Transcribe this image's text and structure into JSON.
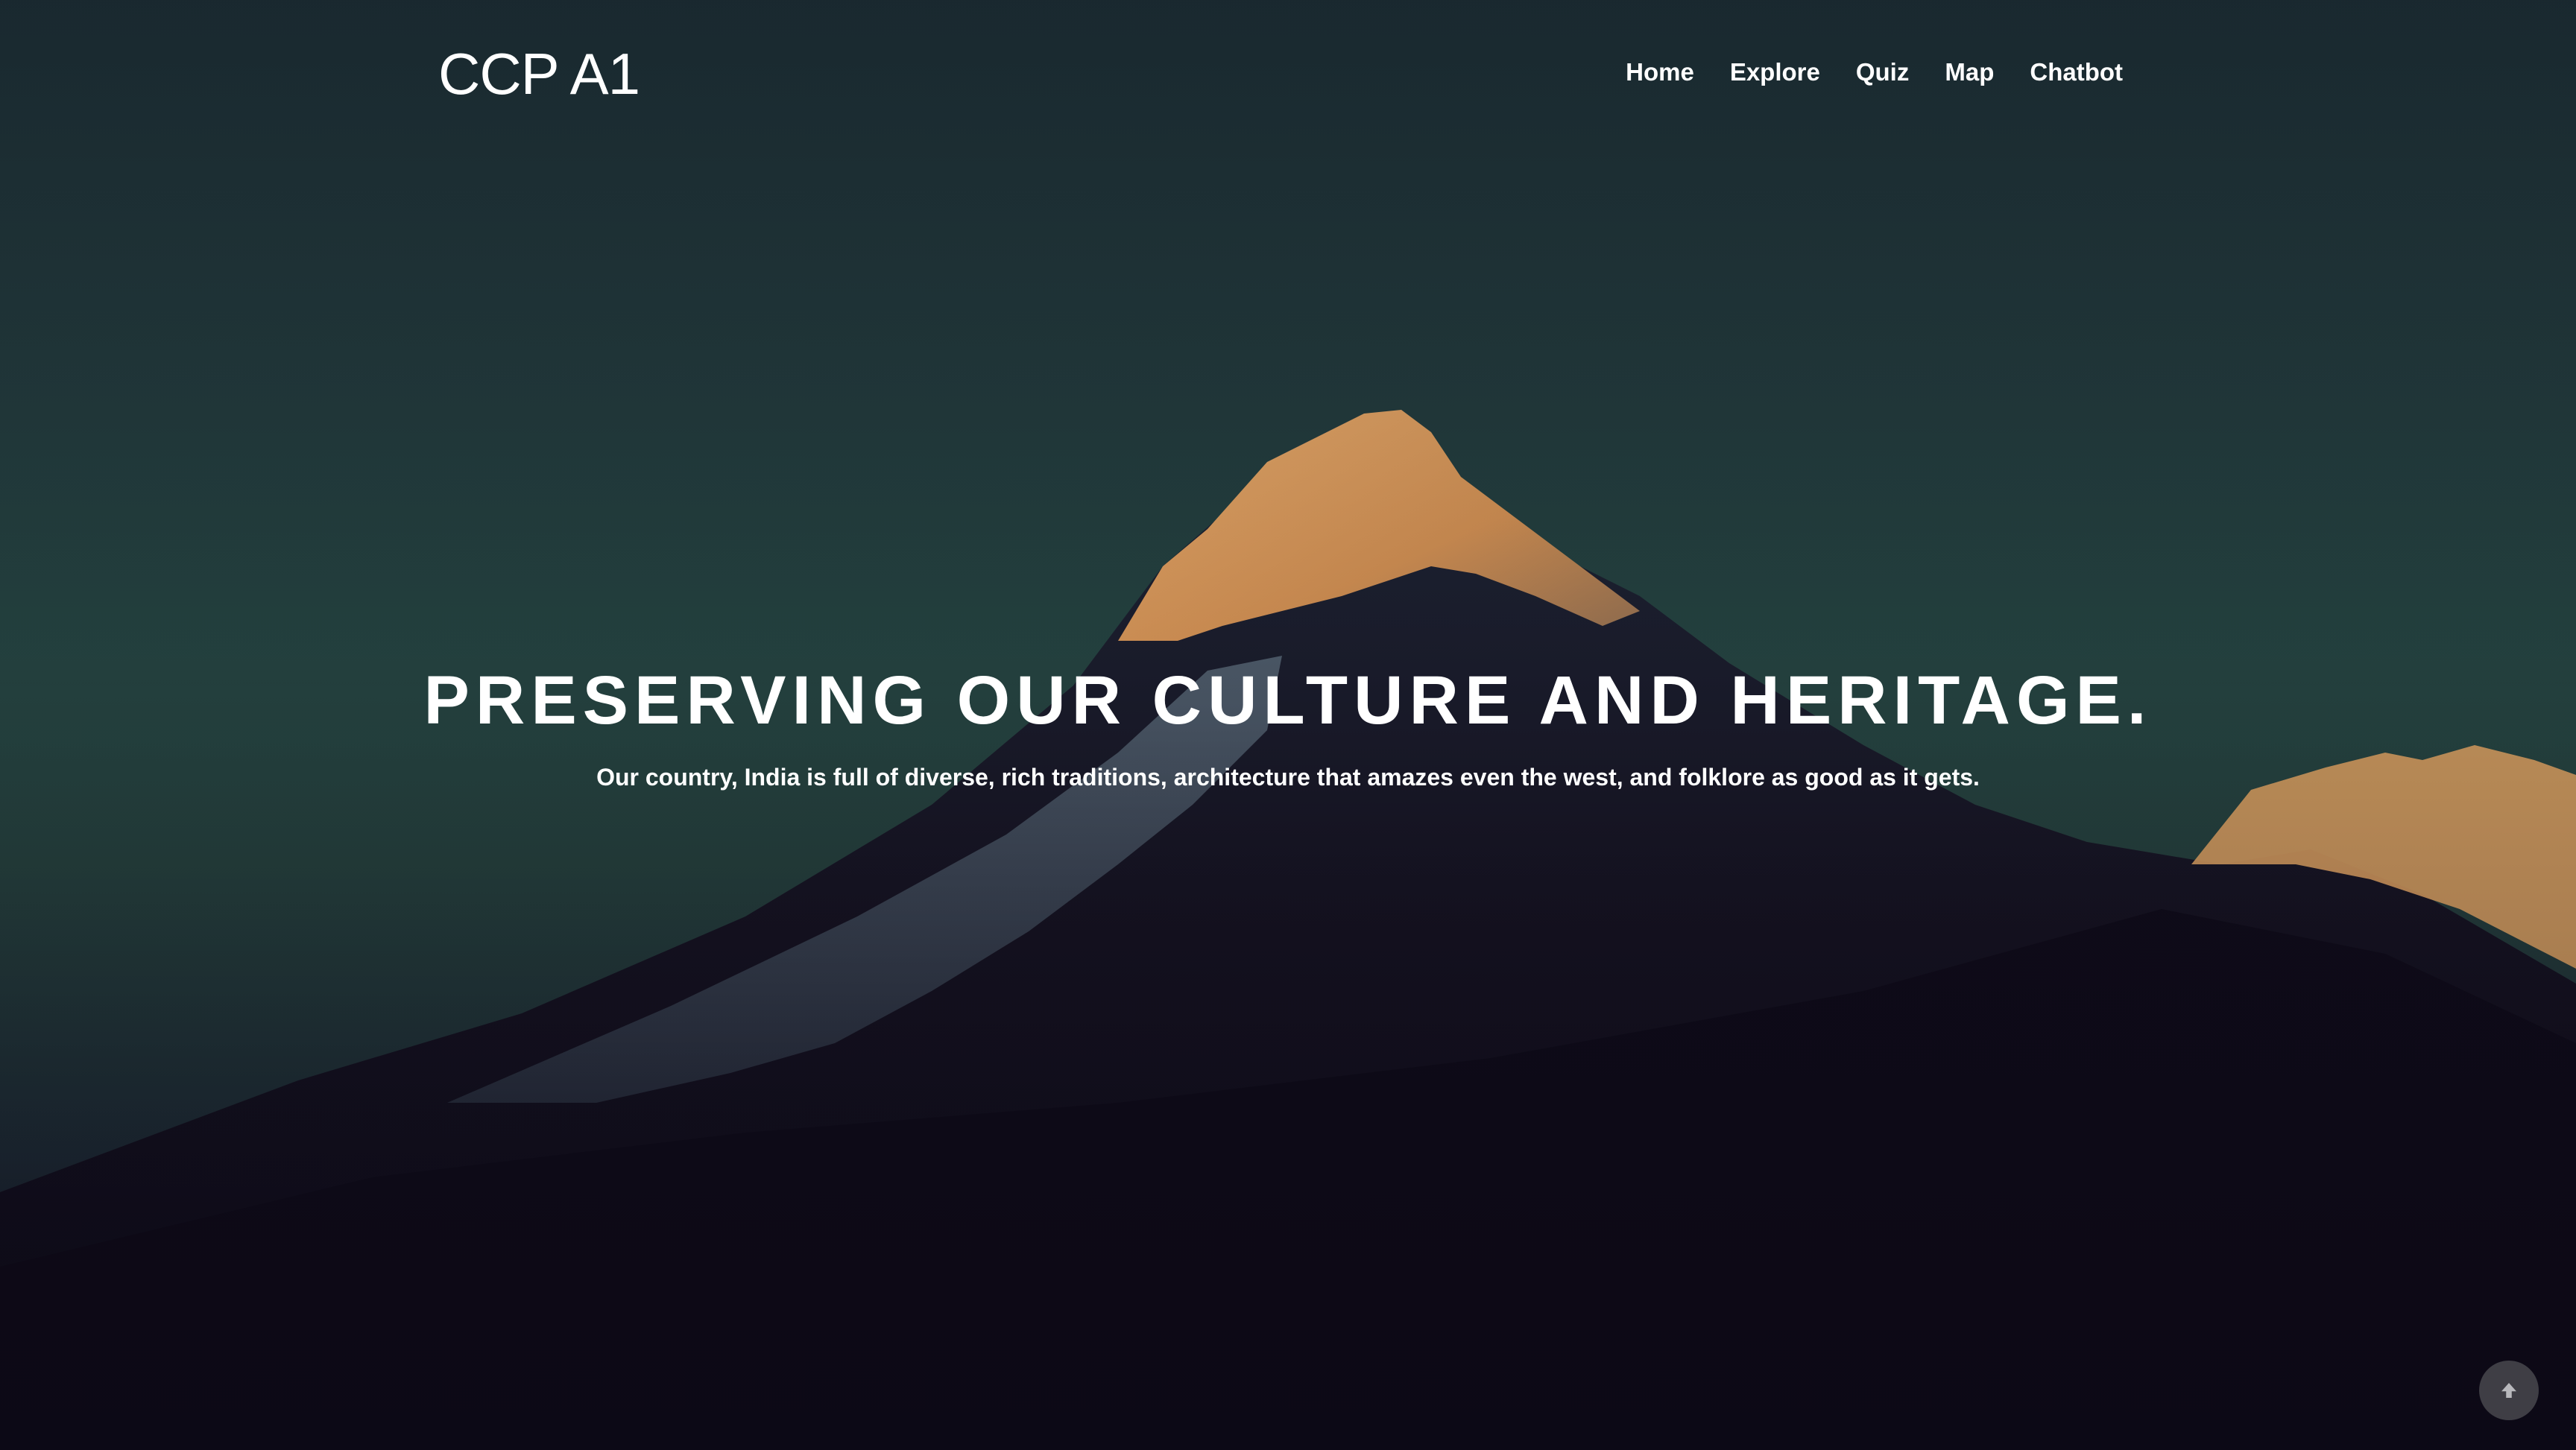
{
  "brand": {
    "title": "CCP A1"
  },
  "nav": {
    "items": [
      {
        "label": "Home"
      },
      {
        "label": "Explore"
      },
      {
        "label": "Quiz"
      },
      {
        "label": "Map"
      },
      {
        "label": "Chatbot"
      }
    ]
  },
  "hero": {
    "title": "PRESERVING OUR CULTURE AND HERITAGE.",
    "subtitle": "Our country, India is full of diverse, rich traditions, architecture that amazes even the west, and folklore as good as it gets."
  },
  "scroll_top": {
    "icon": "arrow-up-icon"
  },
  "colors": {
    "sky_top": "#1c2d34",
    "sky_mid": "#23403e",
    "peak_lit": "#d9975a",
    "mountain_dark": "#100c1c",
    "text": "#ffffff"
  }
}
